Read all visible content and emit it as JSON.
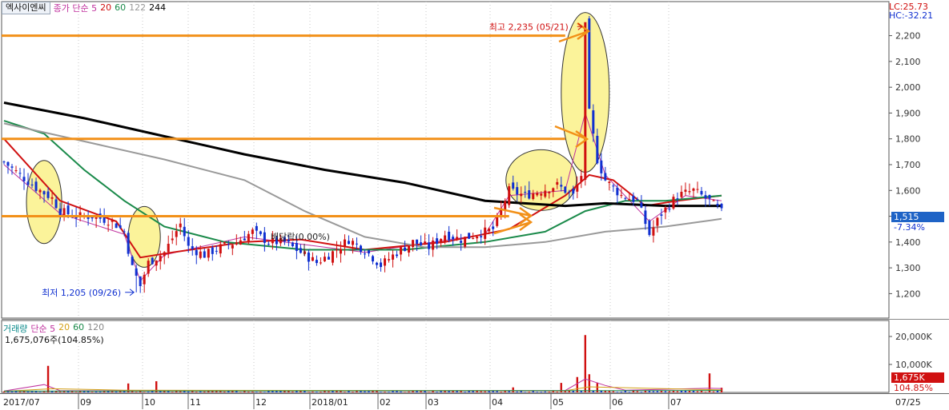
{
  "header": {
    "stock_name": "엑사이엔씨",
    "price_legend": [
      {
        "label": "종가 단순 5",
        "color": "#c0319e"
      },
      {
        "label": "20",
        "color": "#d01010"
      },
      {
        "label": "60",
        "color": "#1a8a4a"
      },
      {
        "label": "122",
        "color": "#999999"
      },
      {
        "label": "244",
        "color": "#000000"
      }
    ],
    "lc_label": "LC:25.73",
    "hc_label": "HC:-32.21"
  },
  "price_panel": {
    "current_price": "1,515",
    "change_pct": "-7.34%",
    "high_annotation": "최고 2,235 (05/21)",
    "low_annotation": "최저 1,205 (09/26)",
    "dividend_annotation": "배당락(0.00%)"
  },
  "volume_panel": {
    "legend": [
      {
        "label": "거래량",
        "color": "#0a8a8a"
      },
      {
        "label": "단순 5",
        "color": "#c0319e"
      },
      {
        "label": "20",
        "color": "#d4a017"
      },
      {
        "label": "60",
        "color": "#1a8a4a"
      },
      {
        "label": "120",
        "color": "#888888"
      }
    ],
    "current_volume": "1,675,076주(104.85%)",
    "current_volume_box": "1,675K",
    "current_volume_pct": "104.85%"
  },
  "colors": {
    "up_candle": "#d01010",
    "down_candle": "#1030d0",
    "annotation_line": "#f29018",
    "highlight_fill": "#fbf39a",
    "current_price_box": "#1e63c6",
    "current_volume_box": "#d01010"
  },
  "chart_data": [
    {
      "type": "candlestick",
      "title": "엑사이엔씨",
      "x_labels": [
        "2017/07",
        "09",
        "10",
        "11",
        "12",
        "2018/01",
        "02",
        "03",
        "04",
        "05",
        "06",
        "07"
      ],
      "x_last_label": "07/25",
      "y_ticks": [
        1200,
        1300,
        1400,
        1500,
        1600,
        1700,
        1800,
        1900,
        2000,
        2100,
        2200
      ],
      "y_tick_labels": [
        "1,200",
        "1,300",
        "1,400",
        "1,500",
        "1,600",
        "1,700",
        "1,800",
        "1,900",
        "2,000",
        "2,100",
        "2,200"
      ],
      "ylim": [
        1130,
        2270
      ],
      "grid": "vertical dotted",
      "close_path": [
        [
          0,
          1710
        ],
        [
          4,
          1660
        ],
        [
          8,
          1610
        ],
        [
          12,
          1570
        ],
        [
          14,
          1520
        ],
        [
          18,
          1500
        ],
        [
          22,
          1500
        ],
        [
          27,
          1480
        ],
        [
          30,
          1440
        ],
        [
          32,
          1300
        ],
        [
          34,
          1230
        ],
        [
          36,
          1320
        ],
        [
          40,
          1360
        ],
        [
          44,
          1470
        ],
        [
          46,
          1380
        ],
        [
          50,
          1350
        ],
        [
          54,
          1380
        ],
        [
          58,
          1400
        ],
        [
          62,
          1440
        ],
        [
          66,
          1400
        ],
        [
          70,
          1400
        ],
        [
          74,
          1360
        ],
        [
          78,
          1320
        ],
        [
          82,
          1360
        ],
        [
          86,
          1410
        ],
        [
          90,
          1370
        ],
        [
          94,
          1310
        ],
        [
          98,
          1360
        ],
        [
          102,
          1400
        ],
        [
          106,
          1380
        ],
        [
          110,
          1430
        ],
        [
          114,
          1410
        ],
        [
          118,
          1430
        ],
        [
          122,
          1450
        ],
        [
          126,
          1600
        ],
        [
          130,
          1580
        ],
        [
          134,
          1600
        ],
        [
          138,
          1620
        ],
        [
          142,
          1580
        ],
        [
          144,
          1660
        ],
        [
          145,
          2235
        ],
        [
          146,
          1900
        ],
        [
          148,
          1720
        ],
        [
          150,
          1640
        ],
        [
          154,
          1580
        ],
        [
          158,
          1560
        ],
        [
          161,
          1430
        ],
        [
          164,
          1510
        ],
        [
          168,
          1580
        ],
        [
          172,
          1600
        ],
        [
          176,
          1560
        ],
        [
          179,
          1515
        ]
      ],
      "highs": [
        {
          "i": 145,
          "v": 2235,
          "label": "최고 2,235 (05/21)"
        }
      ],
      "lows": [
        {
          "i": 33,
          "v": 1205,
          "label": "최저 1,205 (09/26)"
        }
      ],
      "moving_averages": [
        {
          "name": "5",
          "color": "#c0319e",
          "points": [
            [
              0,
              1700
            ],
            [
              14,
              1510
            ],
            [
              30,
              1430
            ],
            [
              34,
              1250
            ],
            [
              40,
              1350
            ],
            [
              60,
              1420
            ],
            [
              90,
              1360
            ],
            [
              120,
              1430
            ],
            [
              126,
              1580
            ],
            [
              140,
              1600
            ],
            [
              145,
              1900
            ],
            [
              150,
              1660
            ],
            [
              161,
              1480
            ],
            [
              170,
              1580
            ],
            [
              179,
              1560
            ]
          ]
        },
        {
          "name": "20",
          "color": "#d01010",
          "points": [
            [
              0,
              1800
            ],
            [
              14,
              1560
            ],
            [
              28,
              1480
            ],
            [
              34,
              1340
            ],
            [
              42,
              1360
            ],
            [
              60,
              1400
            ],
            [
              74,
              1410
            ],
            [
              90,
              1370
            ],
            [
              110,
              1400
            ],
            [
              126,
              1450
            ],
            [
              140,
              1580
            ],
            [
              146,
              1660
            ],
            [
              152,
              1640
            ],
            [
              160,
              1540
            ],
            [
              168,
              1560
            ],
            [
              179,
              1580
            ]
          ]
        },
        {
          "name": "60",
          "color": "#1a8a4a",
          "points": [
            [
              0,
              1870
            ],
            [
              10,
              1820
            ],
            [
              20,
              1680
            ],
            [
              30,
              1560
            ],
            [
              40,
              1460
            ],
            [
              55,
              1400
            ],
            [
              75,
              1370
            ],
            [
              100,
              1370
            ],
            [
              120,
              1400
            ],
            [
              135,
              1440
            ],
            [
              145,
              1520
            ],
            [
              155,
              1560
            ],
            [
              165,
              1560
            ],
            [
              179,
              1580
            ]
          ]
        },
        {
          "name": "122",
          "color": "#999999",
          "points": [
            [
              0,
              1860
            ],
            [
              20,
              1790
            ],
            [
              40,
              1720
            ],
            [
              60,
              1640
            ],
            [
              75,
              1520
            ],
            [
              90,
              1420
            ],
            [
              105,
              1380
            ],
            [
              120,
              1380
            ],
            [
              135,
              1400
            ],
            [
              150,
              1440
            ],
            [
              165,
              1460
            ],
            [
              179,
              1490
            ]
          ]
        },
        {
          "name": "244",
          "color": "#000000",
          "points": [
            [
              0,
              1940
            ],
            [
              20,
              1880
            ],
            [
              40,
              1810
            ],
            [
              60,
              1740
            ],
            [
              80,
              1680
            ],
            [
              100,
              1630
            ],
            [
              120,
              1560
            ],
            [
              140,
              1540
            ],
            [
              150,
              1550
            ],
            [
              165,
              1540
            ],
            [
              179,
              1540
            ]
          ]
        }
      ],
      "horizontal_markers": [
        2200,
        1800,
        1500
      ],
      "point_count": 180
    },
    {
      "type": "bar",
      "title": "거래량",
      "y_ticks": [
        10000,
        20000
      ],
      "y_tick_labels": [
        "10,000K",
        "20,000K"
      ],
      "ylim": [
        0,
        24000
      ],
      "spikes": [
        {
          "i": 11,
          "v": 9500
        },
        {
          "i": 31,
          "v": 3200
        },
        {
          "i": 38,
          "v": 4000
        },
        {
          "i": 127,
          "v": 1800
        },
        {
          "i": 139,
          "v": 3400
        },
        {
          "i": 143,
          "v": 5500
        },
        {
          "i": 145,
          "v": 20500
        },
        {
          "i": 146,
          "v": 6500
        },
        {
          "i": 148,
          "v": 3500
        },
        {
          "i": 176,
          "v": 6800
        },
        {
          "i": 179,
          "v": 1675
        }
      ],
      "baseline_volume": 500,
      "moving_averages": [
        {
          "name": "5",
          "color": "#c0319e"
        },
        {
          "name": "20",
          "color": "#d4a017"
        },
        {
          "name": "60",
          "color": "#1a8a4a"
        },
        {
          "name": "120",
          "color": "#888888"
        }
      ]
    }
  ]
}
